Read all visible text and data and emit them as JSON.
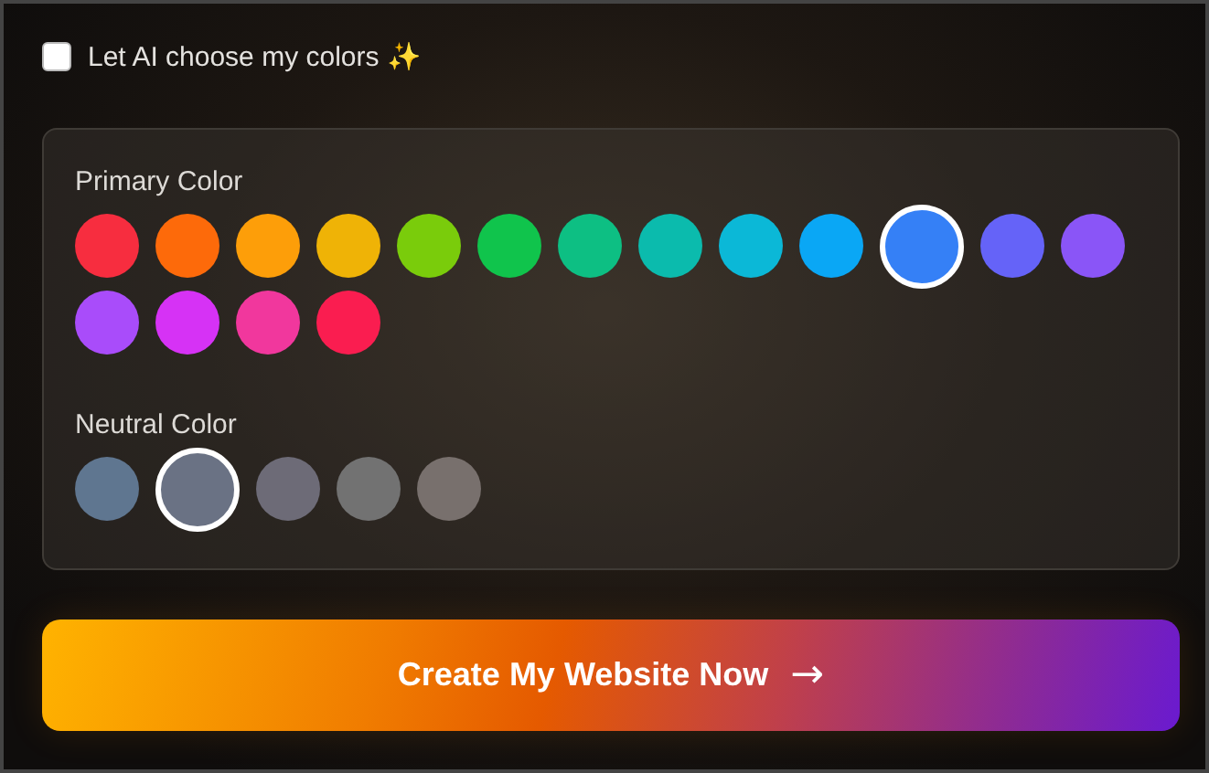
{
  "ai_option": {
    "label": "Let AI choose my colors ✨",
    "checked": false
  },
  "primary": {
    "label": "Primary Color",
    "swatches": [
      {
        "color": "#f72d3f",
        "selected": false
      },
      {
        "color": "#fd6a0a",
        "selected": false
      },
      {
        "color": "#fd9e09",
        "selected": false
      },
      {
        "color": "#efb306",
        "selected": false
      },
      {
        "color": "#7acc0b",
        "selected": false
      },
      {
        "color": "#10c44c",
        "selected": false
      },
      {
        "color": "#0dbf83",
        "selected": false
      },
      {
        "color": "#0bbbad",
        "selected": false
      },
      {
        "color": "#0bb8d7",
        "selected": false
      },
      {
        "color": "#0aa7f5",
        "selected": false
      },
      {
        "color": "#3580f6",
        "selected": true
      },
      {
        "color": "#6563f8",
        "selected": false
      },
      {
        "color": "#8a55f7",
        "selected": false
      },
      {
        "color": "#a94cfa",
        "selected": false
      },
      {
        "color": "#d632f5",
        "selected": false
      },
      {
        "color": "#f1379d",
        "selected": false
      },
      {
        "color": "#fa1d50",
        "selected": false
      }
    ]
  },
  "neutral": {
    "label": "Neutral Color",
    "swatches": [
      {
        "color": "#5f7690",
        "selected": false
      },
      {
        "color": "#6a7284",
        "selected": true
      },
      {
        "color": "#6d6b77",
        "selected": false
      },
      {
        "color": "#727272",
        "selected": false
      },
      {
        "color": "#78706d",
        "selected": false
      }
    ]
  },
  "create_button": {
    "label": "Create My Website Now",
    "icon": "→"
  }
}
